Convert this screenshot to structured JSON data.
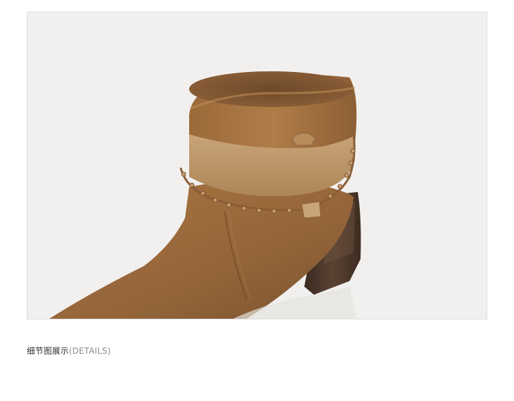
{
  "caption": {
    "zh": "细节图展示",
    "en": "(DETAILS)"
  },
  "photo": {
    "subject": "boot-detail-photo",
    "colors": {
      "background": "#f2f0ee",
      "suede": "#9a6a3a",
      "leather_band": "#c19a6b",
      "heel": "#4a3427"
    }
  }
}
